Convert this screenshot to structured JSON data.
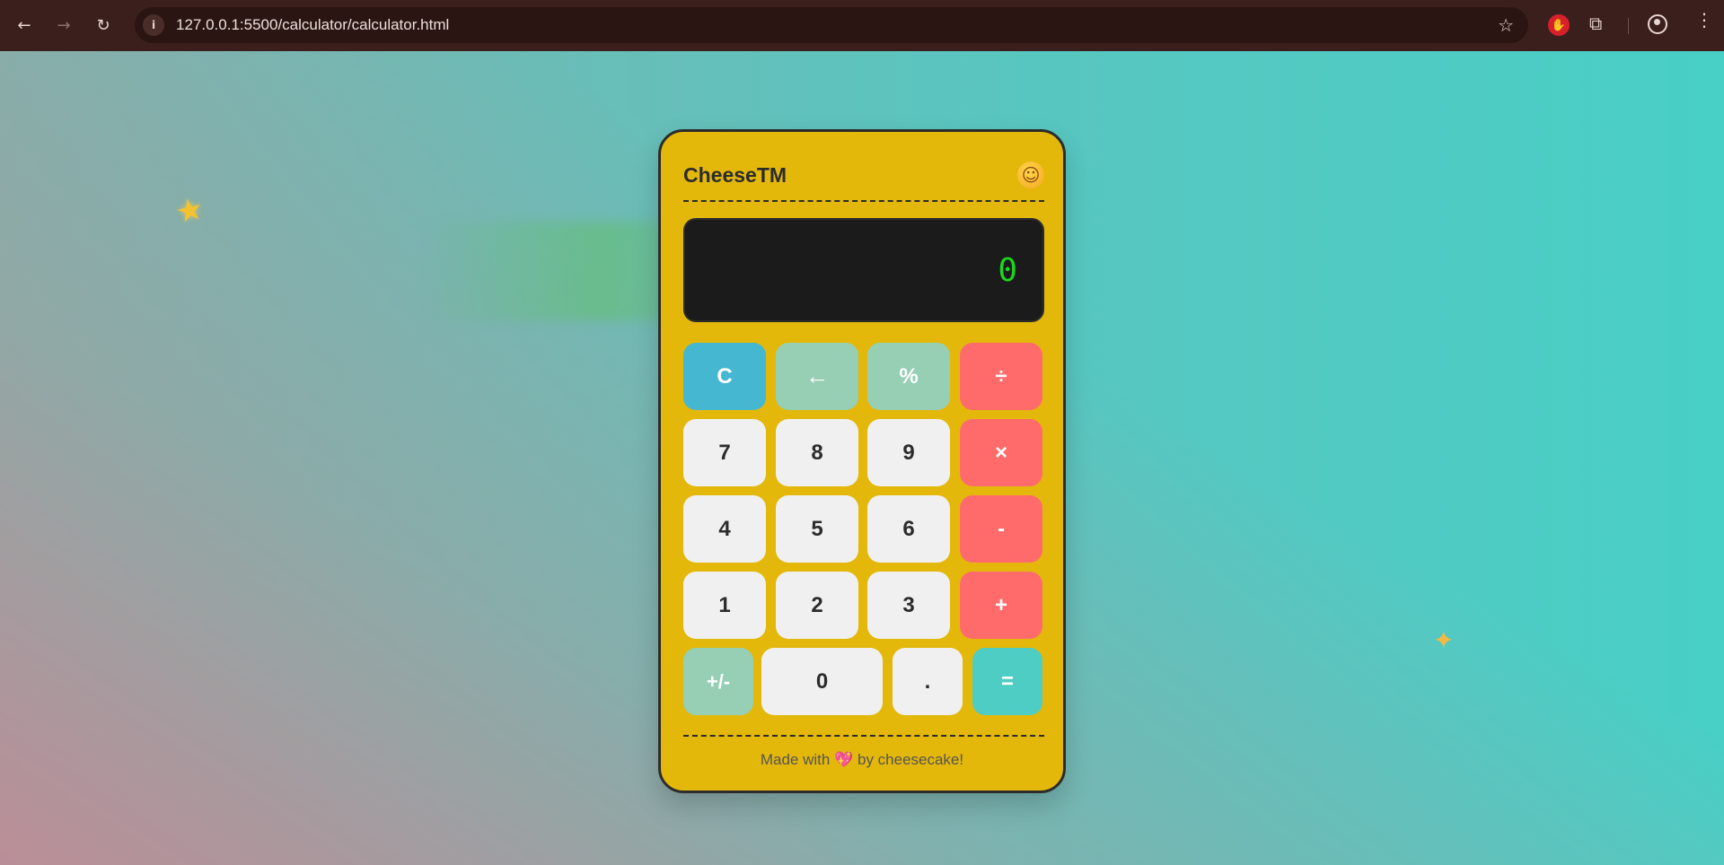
{
  "browser": {
    "url": "127.0.0.1:5500/calculator/calculator.html",
    "icons": [
      "back-icon",
      "forward-icon",
      "reload-icon",
      "site-info-icon",
      "bookmark-star-icon",
      "extension-icon",
      "puzzle-icon",
      "profile-icon",
      "menu-icon"
    ]
  },
  "calculator": {
    "brand": "CheeseTM",
    "mood_icon": "smiley-icon",
    "display": "0",
    "buttons": {
      "clear": "C",
      "backspace": "←",
      "percent": "%",
      "divide": "÷",
      "seven": "7",
      "eight": "8",
      "nine": "9",
      "multiply": "×",
      "four": "4",
      "five": "5",
      "six": "6",
      "minus": "-",
      "one": "1",
      "two": "2",
      "three": "3",
      "plus": "+",
      "negate": "+/-",
      "zero": "0",
      "decimal": ".",
      "equals": "="
    },
    "footer": {
      "prefix": "Made with",
      "heart": "💖",
      "suffix": "by cheesecake!"
    }
  },
  "decorations": [
    "star-icon",
    "sparkle-icon"
  ],
  "colors": {
    "calculator_body": "#e3b80a",
    "display_bg": "#1b1b1b",
    "display_text": "#1ed51e",
    "number_key": "#f0f0f0",
    "clear_key": "#45b7d1",
    "function_key": "#96cfb4",
    "operator_key": "#ff6b6b",
    "equals_key": "#4ecdc4"
  }
}
